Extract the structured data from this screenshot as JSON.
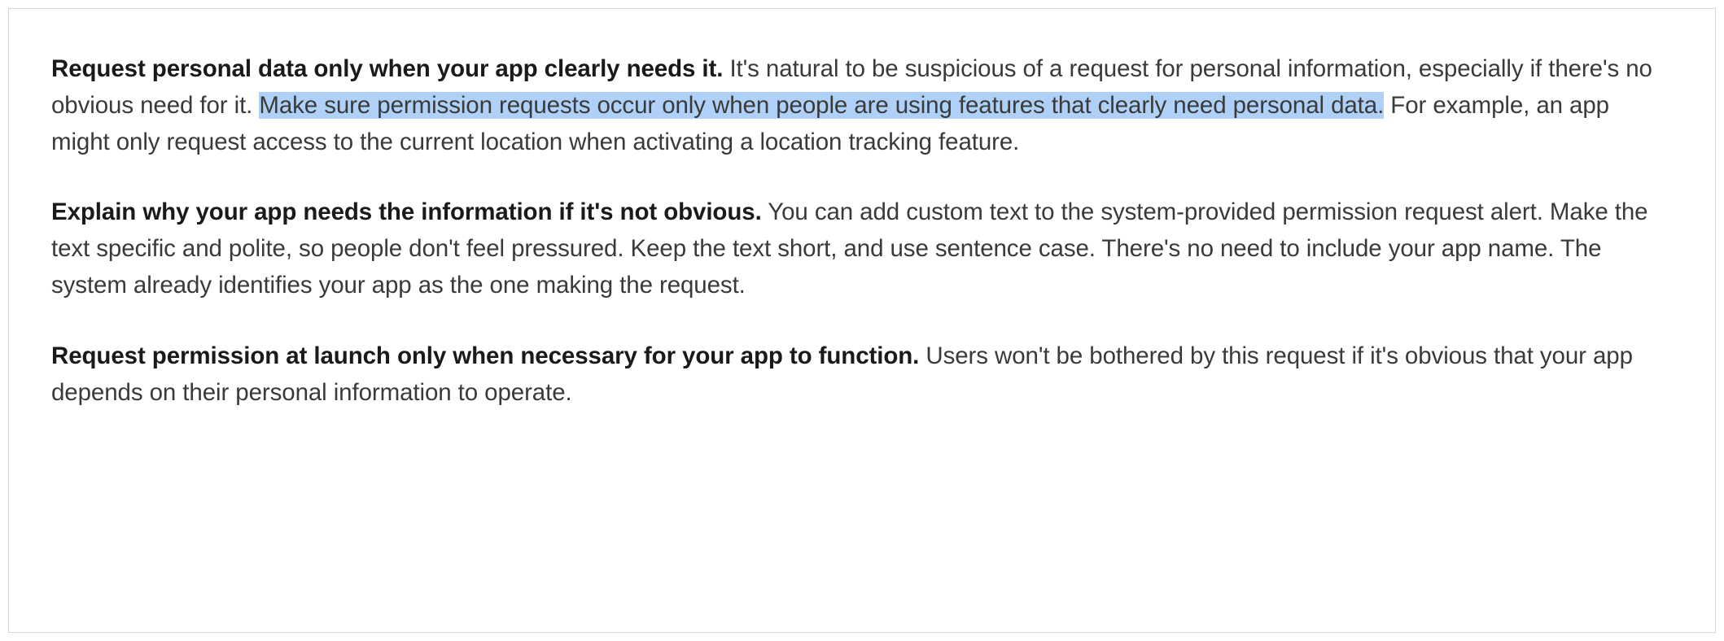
{
  "paragraphs": [
    {
      "lead": "Request personal data only when your app clearly needs it.",
      "body_before_highlight": " It's natural to be suspicious of a request for personal information, especially if there's no obvious need for it. ",
      "highlighted": "Make sure permission requests occur only when people are using features that clearly need personal data.",
      "body_after_highlight": " For example, an app might only request access to the current location when activating a location tracking feature."
    },
    {
      "lead": "Explain why your app needs the information if it's not obvious.",
      "body": " You can add custom text to the system-provided permission request alert. Make the text specific and polite, so people don't feel pressured. Keep the text short, and use sentence case. There's no need to include your app name. The system already identifies your app as the one making the request."
    },
    {
      "lead": "Request permission at launch only when necessary for your app to function.",
      "body": " Users won't be bothered by this request if it's obvious that your app depends on their personal information to operate."
    }
  ]
}
